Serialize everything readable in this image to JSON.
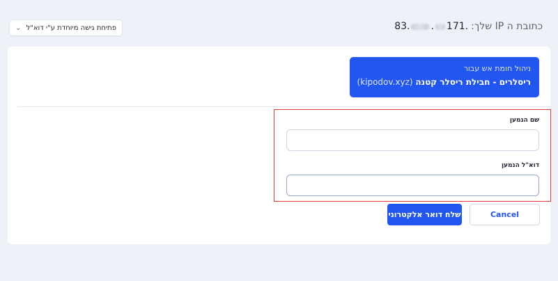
{
  "header": {
    "ip_label": "כתובת ה IP שלך:",
    "ip_prefix": "171.",
    "ip_suffix": "83.",
    "access_select": {
      "selected": "פתיחת גישה מיוחדת ע\"י דוא\"ל",
      "icon": "chevron-down-icon"
    }
  },
  "banner": {
    "title": "ניהול חומת אש עבור",
    "product": "ריסלרים - חבילת ריסלר קטנה",
    "domain": "(kipodov.xyz)"
  },
  "form": {
    "name_label": "שם הנמען",
    "name_value": "",
    "email_label": "דוא\"ל הנמען",
    "email_value": ""
  },
  "actions": {
    "send_label": "שלח דואר אלקטרוני",
    "cancel_label": "Cancel"
  },
  "colors": {
    "accent": "#2256f0",
    "highlight": "#e53935",
    "background": "#eef1f7"
  }
}
